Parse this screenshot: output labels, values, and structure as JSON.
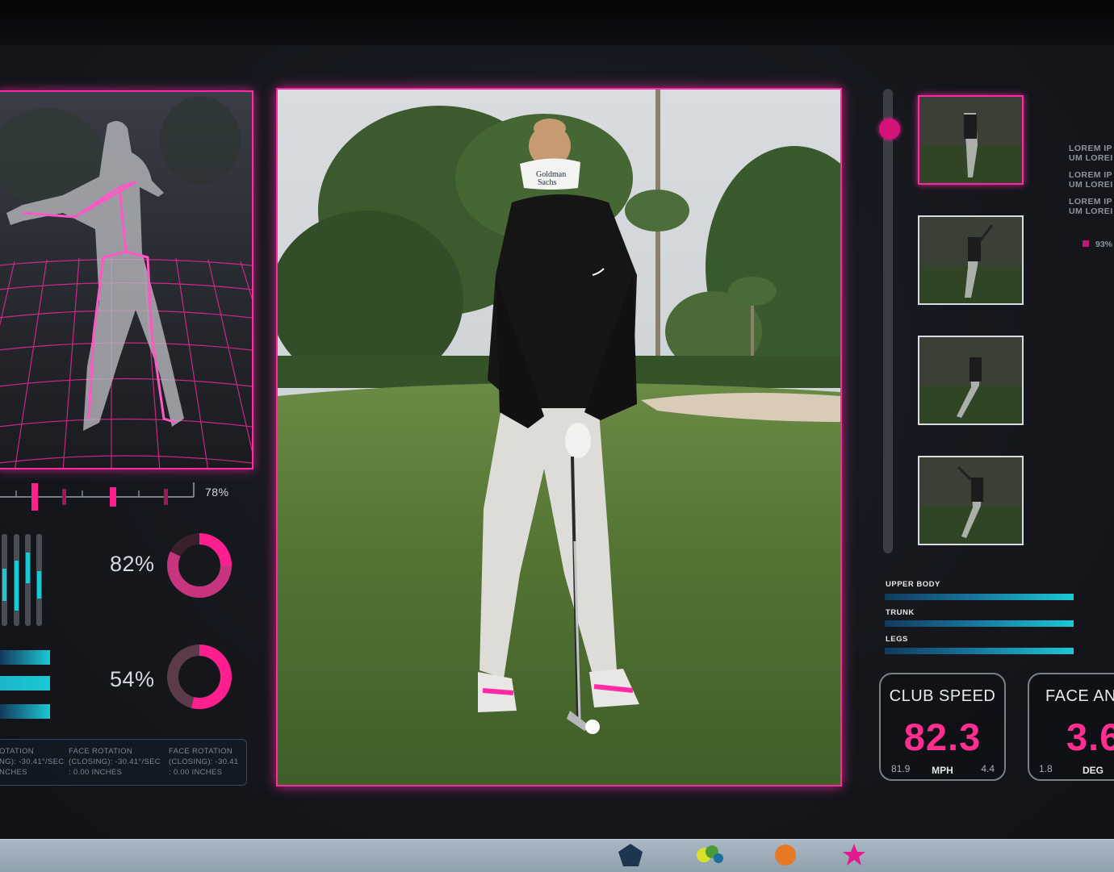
{
  "scrubber": {
    "percent_label": "78%"
  },
  "donuts": [
    {
      "label": "82%",
      "value": 0.82
    },
    {
      "label": "54%",
      "value": 0.54
    }
  ],
  "rotation_info": [
    {
      "line1": "OTATION",
      "line2": "NG): -30.41°/SEC",
      "line3": "NCHES"
    },
    {
      "line1": "FACE ROTATION",
      "line2": "(CLOSING): -30.41°/SEC",
      "line3": ": 0.00 INCHES"
    },
    {
      "line1": "FACE ROTATION",
      "line2": "(CLOSING): -30.41",
      "line3": ": 0.00 INCHES"
    }
  ],
  "side_notes": [
    {
      "line1": "LOREM IP",
      "line2": "UM LOREI"
    },
    {
      "line1": "LOREM IP",
      "line2": "UM LOREI"
    },
    {
      "line1": "LOREM IP",
      "line2": "UM LOREI"
    }
  ],
  "legend": {
    "percent": "93%",
    "color": "#c41672"
  },
  "segments": [
    {
      "label": "UPPER BODY"
    },
    {
      "label": "TRUNK"
    },
    {
      "label": "LEGS"
    }
  ],
  "metrics": [
    {
      "title": "CLUB SPEED",
      "value": "82.3",
      "unit": "MPH",
      "min": "81.9",
      "max": "4.4"
    },
    {
      "title": "FACE ANG",
      "value": "3.6",
      "unit": "DEG",
      "min": "1.8",
      "max": ""
    }
  ],
  "colors": {
    "accent": "#ff2aa4",
    "metric_value": "#ff2e8f",
    "cyan": "#1bc9d4"
  },
  "dock_icons": [
    "pentagon-icon",
    "cluster-icon",
    "orange-ball-icon",
    "pink-star-icon"
  ]
}
